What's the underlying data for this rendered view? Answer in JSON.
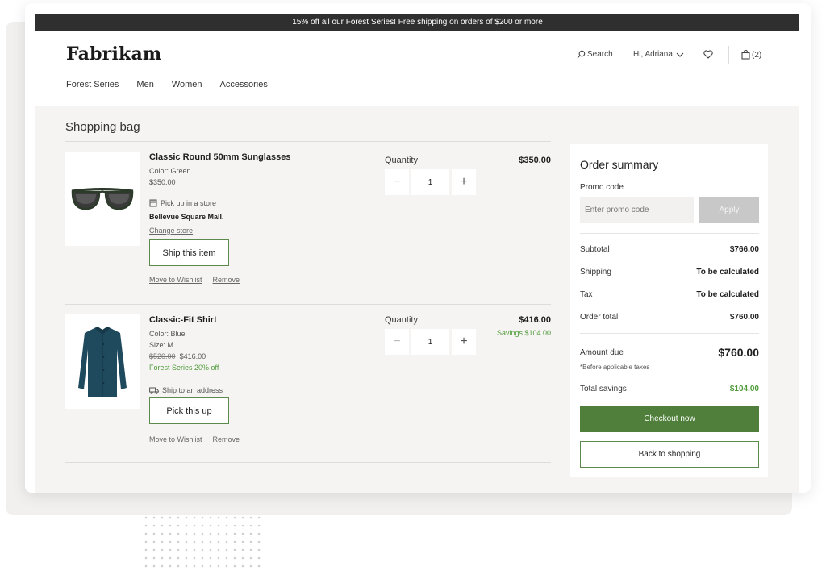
{
  "promo_bar": "15% off all our Forest Series! Free shipping on orders of $200 or more",
  "brand": "Fabrikam",
  "header": {
    "search_label": "Search",
    "user_label": "Hi, Adriana",
    "bag_count": "(2)"
  },
  "nav": [
    "Forest Series",
    "Men",
    "Women",
    "Accessories"
  ],
  "page_title": "Shopping bag",
  "items": [
    {
      "name": "Classic Round 50mm Sunglasses",
      "color": "Color: Green",
      "unit_price": "$350.00",
      "fulfillment": "Pick up in a store",
      "store": "Bellevue Square Mall",
      "change_store": "Change store",
      "action_button": "Ship this item",
      "wishlist": "Move to Wishlist",
      "remove": "Remove",
      "quantity_label": "Quantity",
      "quantity": "1",
      "total": "$350.00"
    },
    {
      "name": "Classic-Fit Shirt",
      "color": "Color: Blue",
      "size": "Size: M",
      "original_price": "$520.00",
      "sale_price": "$416.00",
      "discount": "Forest Series 20% off",
      "fulfillment": "Ship to an address",
      "action_button": "Pick this up",
      "wishlist": "Move to Wishlist",
      "remove": "Remove",
      "quantity_label": "Quantity",
      "quantity": "1",
      "total": "$416.00",
      "savings": "Savings $104.00"
    }
  ],
  "summary": {
    "title": "Order summary",
    "promo_label": "Promo code",
    "promo_placeholder": "Enter promo code",
    "apply": "Apply",
    "subtotal_label": "Subtotal",
    "subtotal": "$766.00",
    "shipping_label": "Shipping",
    "shipping": "To be calculated",
    "tax_label": "Tax",
    "tax": "To be calculated",
    "order_total_label": "Order total",
    "order_total": "$760.00",
    "amount_due_label": "Amount due",
    "amount_due": "$760.00",
    "note": "*Before applicable taxes",
    "savings_label": "Total savings",
    "savings": "$104.00",
    "checkout": "Checkout now",
    "back": "Back to shopping"
  },
  "colors": {
    "accent_green": "#4f7f3a",
    "savings_green": "#4f9a3a",
    "promo_bar": "#2f2f2f"
  }
}
